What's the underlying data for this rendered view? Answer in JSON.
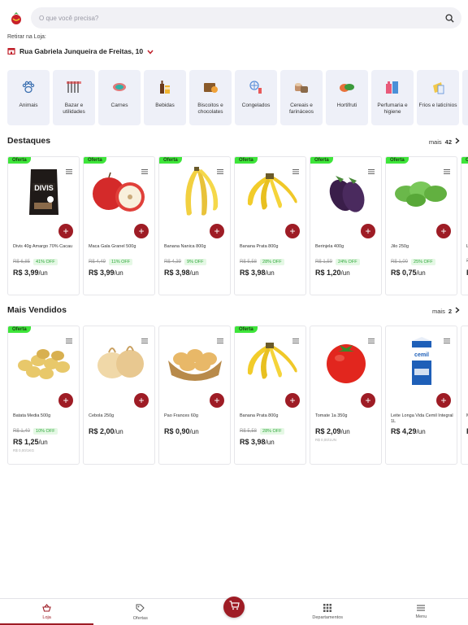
{
  "search": {
    "placeholder": "O que você precisa?"
  },
  "store": {
    "label": "Retirar na Loja:",
    "name": "Rua Gabriela Junqueira de Freitas, 10"
  },
  "categories": [
    {
      "label": "Animais",
      "icon": "paw-icon"
    },
    {
      "label": "Bazar e utilidades",
      "icon": "utensils-icon"
    },
    {
      "label": "Carnes",
      "icon": "meat-icon"
    },
    {
      "label": "Bebidas",
      "icon": "drinks-icon"
    },
    {
      "label": "Biscoitos e chocolates",
      "icon": "cookies-icon"
    },
    {
      "label": "Congelados",
      "icon": "frozen-icon"
    },
    {
      "label": "Cereais e farináceos",
      "icon": "cereals-icon"
    },
    {
      "label": "Hortifruti",
      "icon": "vegetables-icon"
    },
    {
      "label": "Perfumaria e higiene",
      "icon": "perfume-icon"
    },
    {
      "label": "Frios e laticínios",
      "icon": "dairy-icon"
    }
  ],
  "destaques": {
    "title": "Destaques",
    "more_label": "mais",
    "more_count": "42",
    "products": [
      {
        "badge": "Oferta",
        "name": "Divis 40g Amargo 70% Cacau",
        "old_price": "R$ 6,85",
        "off": "41% OFF",
        "price": "R$ 3,99",
        "unit": "/un"
      },
      {
        "badge": "Oferta",
        "name": "Maca Gala Granel 500g",
        "old_price": "R$ 4,49",
        "off": "11% OFF",
        "price": "R$ 3,99",
        "unit": "/un"
      },
      {
        "badge": "Oferta",
        "name": "Banana Nanica 800g",
        "old_price": "R$ 4,39",
        "off": "9% OFF",
        "price": "R$ 3,98",
        "unit": "/un"
      },
      {
        "badge": "Oferta",
        "name": "Banana Prata 800g",
        "old_price": "R$ 5,58",
        "off": "28% OFF",
        "price": "R$ 3,98",
        "unit": "/un"
      },
      {
        "badge": "Oferta",
        "name": "Berinjela 400g",
        "old_price": "R$ 1,59",
        "off": "24% OFF",
        "price": "R$ 1,20",
        "unit": "/un"
      },
      {
        "badge": "Oferta",
        "name": "Jilo 250g",
        "old_price": "R$ 1,00",
        "off": "25% OFF",
        "price": "R$ 0,75",
        "unit": "/un"
      },
      {
        "badge": "O",
        "name": "Lo",
        "old_price": "R",
        "off": "",
        "price": "R",
        "unit": ""
      }
    ]
  },
  "mais_vendidos": {
    "title": "Mais Vendidos",
    "more_label": "mais",
    "more_count": "2",
    "products": [
      {
        "badge": "Oferta",
        "name": "Batata Media 500g",
        "old_price": "R$ 1,40",
        "off": "10% OFF",
        "price": "R$ 1,25",
        "unit": "/un",
        "note": "R$ 0,00/1KG"
      },
      {
        "badge": "",
        "name": "Cebola 250g",
        "old_price": "",
        "off": "",
        "price": "R$ 2,00",
        "unit": "/un",
        "note": ""
      },
      {
        "badge": "",
        "name": "Pao Frances 60g",
        "old_price": "",
        "off": "",
        "price": "R$ 0,90",
        "unit": "/un",
        "note": ""
      },
      {
        "badge": "Oferta",
        "name": "Banana Prata 800g",
        "old_price": "R$ 5,58",
        "off": "28% OFF",
        "price": "R$ 3,98",
        "unit": "/un",
        "note": ""
      },
      {
        "badge": "",
        "name": "Tomate 1a 350g",
        "old_price": "",
        "off": "",
        "price": "R$ 2,09",
        "unit": "/un",
        "note": "R$ 0,00/1UN"
      },
      {
        "badge": "",
        "name": "Leite Longa Vida Cemil Integral 1L",
        "old_price": "",
        "off": "",
        "price": "R$ 4,29",
        "unit": "/un",
        "note": ""
      },
      {
        "badge": "",
        "name": "M",
        "old_price": "",
        "off": "",
        "price": "R",
        "unit": "",
        "note": ""
      }
    ]
  },
  "nav": {
    "loja": "Loja",
    "ofertas": "Ofertas",
    "departamentos": "Departamentos",
    "menu": "Menu"
  },
  "colors": {
    "accent": "#9e1c25",
    "offer_badge": "#3ee53a",
    "category_bg": "#eef0f8"
  }
}
